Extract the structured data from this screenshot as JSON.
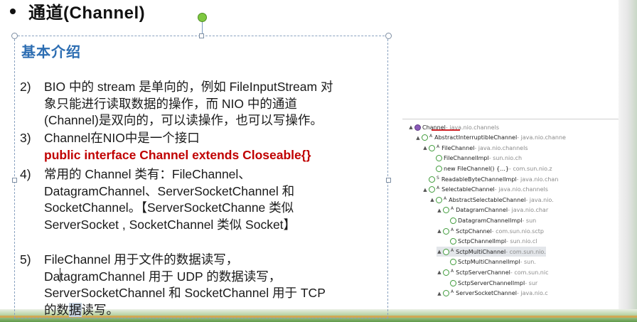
{
  "slide": {
    "title": "通道(Channel)",
    "heading": "基本介绍",
    "items": [
      {
        "num": "2)",
        "lines": [
          "BIO 中的 stream 是单向的，例如 FileInputStream 对",
          "象只能进行读取数据的操作，而 NIO 中的通道",
          "(Channel)是双向的，可以读操作，也可以写操作。"
        ]
      },
      {
        "num": "3)",
        "lines": [
          "Channel在NIO中是一个接口"
        ],
        "code": "public interface Channel extends Closeable{}"
      },
      {
        "num": "4)",
        "lines": [
          "常用的 Channel 类有：FileChannel、",
          "DatagramChannel、ServerSocketChannel 和",
          "SocketChannel。【ServerSocketChanne 类似",
          "ServerSocket , SocketChannel 类似 Socket】"
        ]
      },
      {
        "num": "5)",
        "lines": [
          "FileChannel 用于文件的数据读写，",
          "DatagramChannel 用于 UDP 的数据读写，",
          "ServerSocketChannel 和 SocketChannel 用于 TCP"
        ],
        "last_before": "的数",
        "last_selected": "据",
        "last_after": "读写。"
      }
    ]
  },
  "hierarchy": {
    "rows": [
      {
        "name": "Channel",
        "pkg": " - java.nio.channels",
        "icon": "interface-icon",
        "indent": 0,
        "arrow": "▲"
      },
      {
        "name": "AbstractInterruptibleChannel",
        "pkg": " - java.nio.channe",
        "icon": "class-icon",
        "sup": "A",
        "indent": 1,
        "arrow": "▲"
      },
      {
        "name": "FileChannel",
        "pkg": " - java.nio.channels",
        "icon": "class-icon",
        "sup": "A",
        "indent": 2,
        "arrow": "▲"
      },
      {
        "name": "FileChannelImpl",
        "pkg": " - sun.nio.ch",
        "icon": "class-icon",
        "indent": 3,
        "arrow": ""
      },
      {
        "name": "new FileChannel() {...}",
        "pkg": " - com.sun.nio.z",
        "icon": "class-icon",
        "indent": 3,
        "arrow": ""
      },
      {
        "name": "ReadableByteChannelImpl",
        "pkg": " - java.nio.chan",
        "icon": "class-icon",
        "sup": "S",
        "indent": 2,
        "arrow": ""
      },
      {
        "name": "SelectableChannel",
        "pkg": " - java.nio.channels",
        "icon": "class-icon",
        "sup": "A",
        "indent": 2,
        "arrow": "▲"
      },
      {
        "name": "AbstractSelectableChannel",
        "pkg": " - java.nio.",
        "icon": "class-icon",
        "sup": "A",
        "indent": 3,
        "arrow": "▲"
      },
      {
        "name": "DatagramChannel",
        "pkg": " - java.nio.char",
        "icon": "class-icon",
        "sup": "A",
        "indent": 4,
        "arrow": "▲"
      },
      {
        "name": "DatagramChannelImpl",
        "pkg": " - sun",
        "icon": "class-icon",
        "indent": 5,
        "arrow": ""
      },
      {
        "name": "SctpChannel",
        "pkg": " - com.sun.nio.sctp",
        "icon": "class-icon",
        "sup": "A",
        "indent": 4,
        "arrow": "▲"
      },
      {
        "name": "SctpChannelImpl",
        "pkg": " - sun.nio.cl",
        "icon": "class-icon",
        "indent": 5,
        "arrow": ""
      },
      {
        "name": "SctpMultiChannel",
        "pkg": " - com.sun.nio.",
        "icon": "class-icon",
        "sup": "A",
        "indent": 4,
        "arrow": "▲",
        "highlight": true
      },
      {
        "name": "SctpMultiChannelImpl",
        "pkg": " - sun.",
        "icon": "class-icon",
        "indent": 5,
        "arrow": ""
      },
      {
        "name": "SctpServerChannel",
        "pkg": " - com.sun.nic",
        "icon": "class-icon",
        "sup": "A",
        "indent": 4,
        "arrow": "▲"
      },
      {
        "name": "SctpServerChannelImpl",
        "pkg": " - sur",
        "icon": "class-icon",
        "indent": 5,
        "arrow": ""
      },
      {
        "name": "ServerSocketChannel",
        "pkg": " - java.nio.c",
        "icon": "class-icon",
        "sup": "A",
        "indent": 4,
        "arrow": "▲"
      }
    ]
  },
  "colors": {
    "heading": "#2c6db2",
    "code": "#c00000",
    "accent_green": "#7ec840"
  }
}
